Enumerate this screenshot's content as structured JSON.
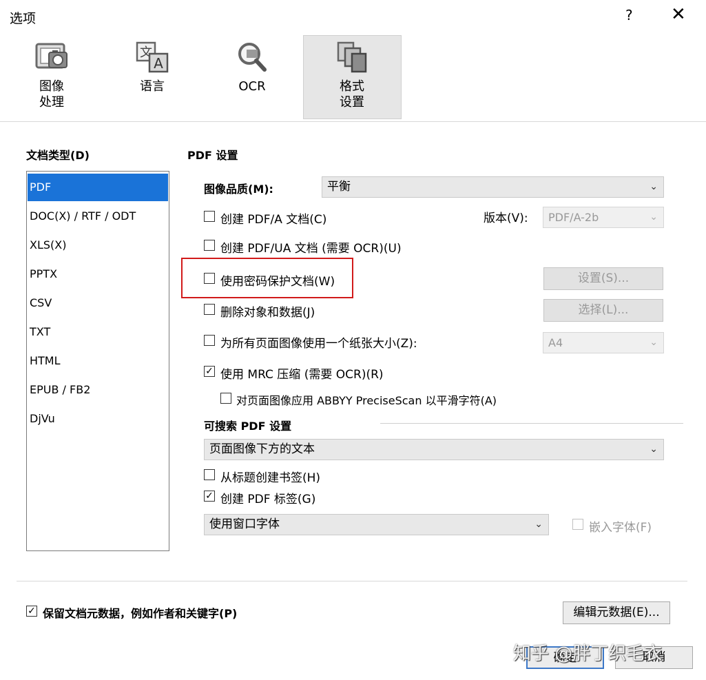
{
  "window": {
    "title": "选项",
    "help": "?",
    "close": "✕"
  },
  "toolbar": {
    "items": [
      {
        "line1": "图像",
        "line2": "处理",
        "icon": "image-processing-icon"
      },
      {
        "line1": "语言",
        "line2": "",
        "icon": "language-icon"
      },
      {
        "line1": "OCR",
        "line2": "",
        "icon": "ocr-icon"
      },
      {
        "line1": "格式",
        "line2": "设置",
        "icon": "format-settings-icon"
      }
    ],
    "selected_index": 3
  },
  "doc_types": {
    "label": "文档类型(D)",
    "items": [
      "PDF",
      "DOC(X) / RTF / ODT",
      "XLS(X)",
      "PPTX",
      "CSV",
      "TXT",
      "HTML",
      "EPUB / FB2",
      "DjVu"
    ],
    "selected": "PDF"
  },
  "pdf": {
    "section": "PDF 设置",
    "quality_label": "图像品质(M):",
    "quality_value": "平衡",
    "pdfa_label": "创建 PDF/A 文档(C)",
    "pdfa_checked": false,
    "version_label": "版本(V):",
    "version_value": "PDF/A-2b",
    "pdfua_label": "创建 PDF/UA 文档 (需要 OCR)(U)",
    "pdfua_checked": false,
    "password_label": "使用密码保护文档(W)",
    "password_checked": false,
    "settings_button": "设置(S)...",
    "delete_label": "删除对象和数据(J)",
    "delete_checked": false,
    "select_button": "选择(L)...",
    "papersize_label": "为所有页面图像使用一个纸张大小(Z):",
    "papersize_checked": false,
    "papersize_value": "A4",
    "mrc_label": "使用 MRC 压缩 (需要 OCR)(R)",
    "mrc_checked": true,
    "precisescan_label": "对页面图像应用 ABBYY PreciseScan 以平滑字符(A)",
    "precisescan_checked": false
  },
  "searchable": {
    "section": "可搜索 PDF 设置",
    "mode_value": "页面图像下方的文本",
    "bookmarks_label": "从标题创建书签(H)",
    "bookmarks_checked": false,
    "tags_label": "创建 PDF 标签(G)",
    "tags_checked": true,
    "font_value": "使用窗口字体",
    "embed_label": "嵌入字体(F)",
    "embed_checked": false
  },
  "footer": {
    "metadata_label": "保留文档元数据，例如作者和关键字(P)",
    "metadata_checked": true,
    "edit_metadata_button": "编辑元数据(E)...",
    "ok_button": "确定",
    "cancel_button": "取消"
  },
  "watermark": "知乎 @胖丁织毛衣",
  "colors": {
    "selection": "#1a73d8",
    "highlight": "#d11a1a"
  }
}
